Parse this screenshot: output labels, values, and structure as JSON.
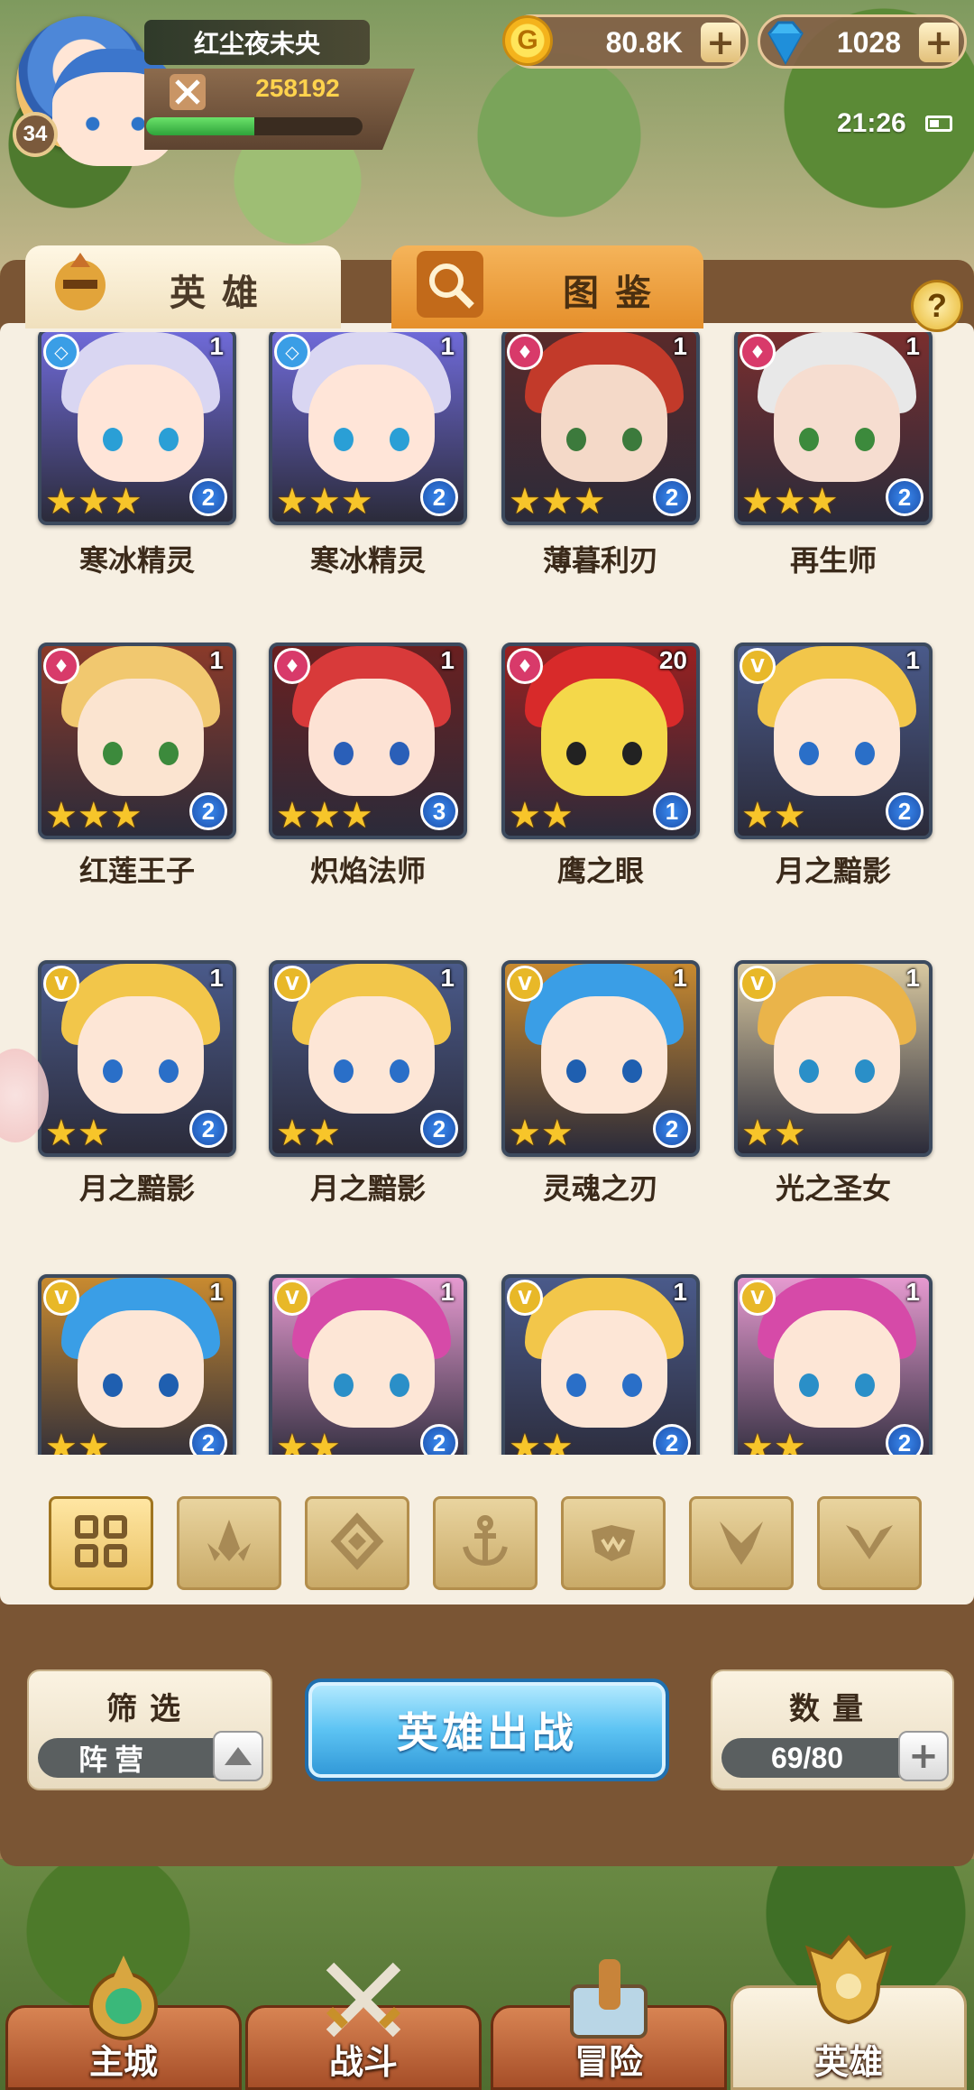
{
  "player": {
    "name": "红尘夜未央",
    "level": "34",
    "power": "258192",
    "exp_fraction": 0.5
  },
  "currency": {
    "gold": "80.8K",
    "gems": "1028"
  },
  "status": {
    "time": "21:26"
  },
  "tabs": {
    "heroes": "英雄",
    "codex": "图鉴"
  },
  "help_label": "?",
  "heroes": [
    {
      "name": "寒冰精灵",
      "count": "1",
      "stars": 3,
      "grade": "2",
      "faction": "water",
      "hair": "#d9d6f2",
      "face": "#ffe5d8",
      "eye": "#2a9fd6",
      "bg": "#6f6ad8"
    },
    {
      "name": "寒冰精灵",
      "count": "1",
      "stars": 3,
      "grade": "2",
      "faction": "water",
      "hair": "#d9d6f2",
      "face": "#ffe5d8",
      "eye": "#2a9fd6",
      "bg": "#6f6ad8"
    },
    {
      "name": "薄暮利刃",
      "count": "1",
      "stars": 3,
      "grade": "2",
      "faction": "fire",
      "hair": "#c23a2a",
      "face": "#f4d9c8",
      "eye": "#3c7a3c",
      "bg": "#5a2a2a"
    },
    {
      "name": "再生师",
      "count": "1",
      "stars": 3,
      "grade": "2",
      "faction": "fire",
      "hair": "#e8e8e8",
      "face": "#f6ddd0",
      "eye": "#3c8a3c",
      "bg": "#7a2e2e"
    },
    {
      "name": "红莲王子",
      "count": "1",
      "stars": 3,
      "grade": "2",
      "faction": "fire",
      "hair": "#f1c86f",
      "face": "#fbe4d0",
      "eye": "#3c8a3c",
      "bg": "#8a3a2a"
    },
    {
      "name": "炽焰法师",
      "count": "1",
      "stars": 3,
      "grade": "3",
      "faction": "fire",
      "hair": "#d83a3a",
      "face": "#fde2d4",
      "eye": "#2a5fb8",
      "bg": "#6a2020"
    },
    {
      "name": "鹰之眼",
      "count": "20",
      "stars": 2,
      "grade": "1",
      "faction": "fire",
      "hair": "#d82a2a",
      "face": "#f4d84a",
      "eye": "#222222",
      "bg": "#9a2020"
    },
    {
      "name": "月之黯影",
      "count": "1",
      "stars": 2,
      "grade": "2",
      "faction": "light",
      "hair": "#f2c64a",
      "face": "#fde6d6",
      "eye": "#2a6fc8",
      "bg": "#4a5a8a"
    },
    {
      "name": "月之黯影",
      "count": "1",
      "stars": 2,
      "grade": "2",
      "faction": "light",
      "hair": "#f2c64a",
      "face": "#fde6d6",
      "eye": "#2a6fc8",
      "bg": "#4a5a8a"
    },
    {
      "name": "月之黯影",
      "count": "1",
      "stars": 2,
      "grade": "2",
      "faction": "light",
      "hair": "#f2c64a",
      "face": "#fde6d6",
      "eye": "#2a6fc8",
      "bg": "#4a5a8a"
    },
    {
      "name": "灵魂之刃",
      "count": "1",
      "stars": 2,
      "grade": "2",
      "faction": "light",
      "hair": "#3a9ee6",
      "face": "#fde6d6",
      "eye": "#1f5fb0",
      "bg": "#c88a30"
    },
    {
      "name": "光之圣女",
      "count": "1",
      "stars": 2,
      "grade": "",
      "faction": "light",
      "hair": "#eab44a",
      "face": "#fde6d6",
      "eye": "#2a8fc8",
      "bg": "#d8c8a0"
    },
    {
      "name": "",
      "count": "1",
      "stars": 2,
      "grade": "2",
      "faction": "light",
      "hair": "#3a9ee6",
      "face": "#fde6d6",
      "eye": "#1f5fb0",
      "bg": "#c88a30"
    },
    {
      "name": "",
      "count": "1",
      "stars": 2,
      "grade": "2",
      "faction": "light",
      "hair": "#d64aa8",
      "face": "#fde6d6",
      "eye": "#2a8fc8",
      "bg": "#e69ad0"
    },
    {
      "name": "",
      "count": "1",
      "stars": 2,
      "grade": "2",
      "faction": "light",
      "hair": "#f2c64a",
      "face": "#fde6d6",
      "eye": "#2a6fc8",
      "bg": "#4a5a8a"
    },
    {
      "name": "",
      "count": "1",
      "stars": 2,
      "grade": "2",
      "faction": "light",
      "hair": "#d64aa8",
      "face": "#fde6d6",
      "eye": "#2a8fc8",
      "bg": "#e69ad0"
    }
  ],
  "faction_colors": {
    "water": "#3a9ee6",
    "fire": "#d83a6a",
    "light": "#e8b828"
  },
  "filters": [
    "all-icon",
    "fire-faction-icon",
    "water-faction-icon",
    "anchor-icon",
    "beast-icon",
    "dark-faction-icon",
    "light-faction-icon"
  ],
  "controls": {
    "filter_title": "筛选",
    "filter_value": "阵营",
    "deploy_label": "英雄出战",
    "count_title": "数量",
    "count_value": "69/80"
  },
  "nav": [
    {
      "label": "主城",
      "icon": "castle-icon",
      "active": false
    },
    {
      "label": "战斗",
      "icon": "crossed-swords-icon",
      "active": false
    },
    {
      "label": "冒险",
      "icon": "map-scroll-icon",
      "active": false
    },
    {
      "label": "英雄",
      "icon": "hero-helmet-icon",
      "active": true
    }
  ]
}
